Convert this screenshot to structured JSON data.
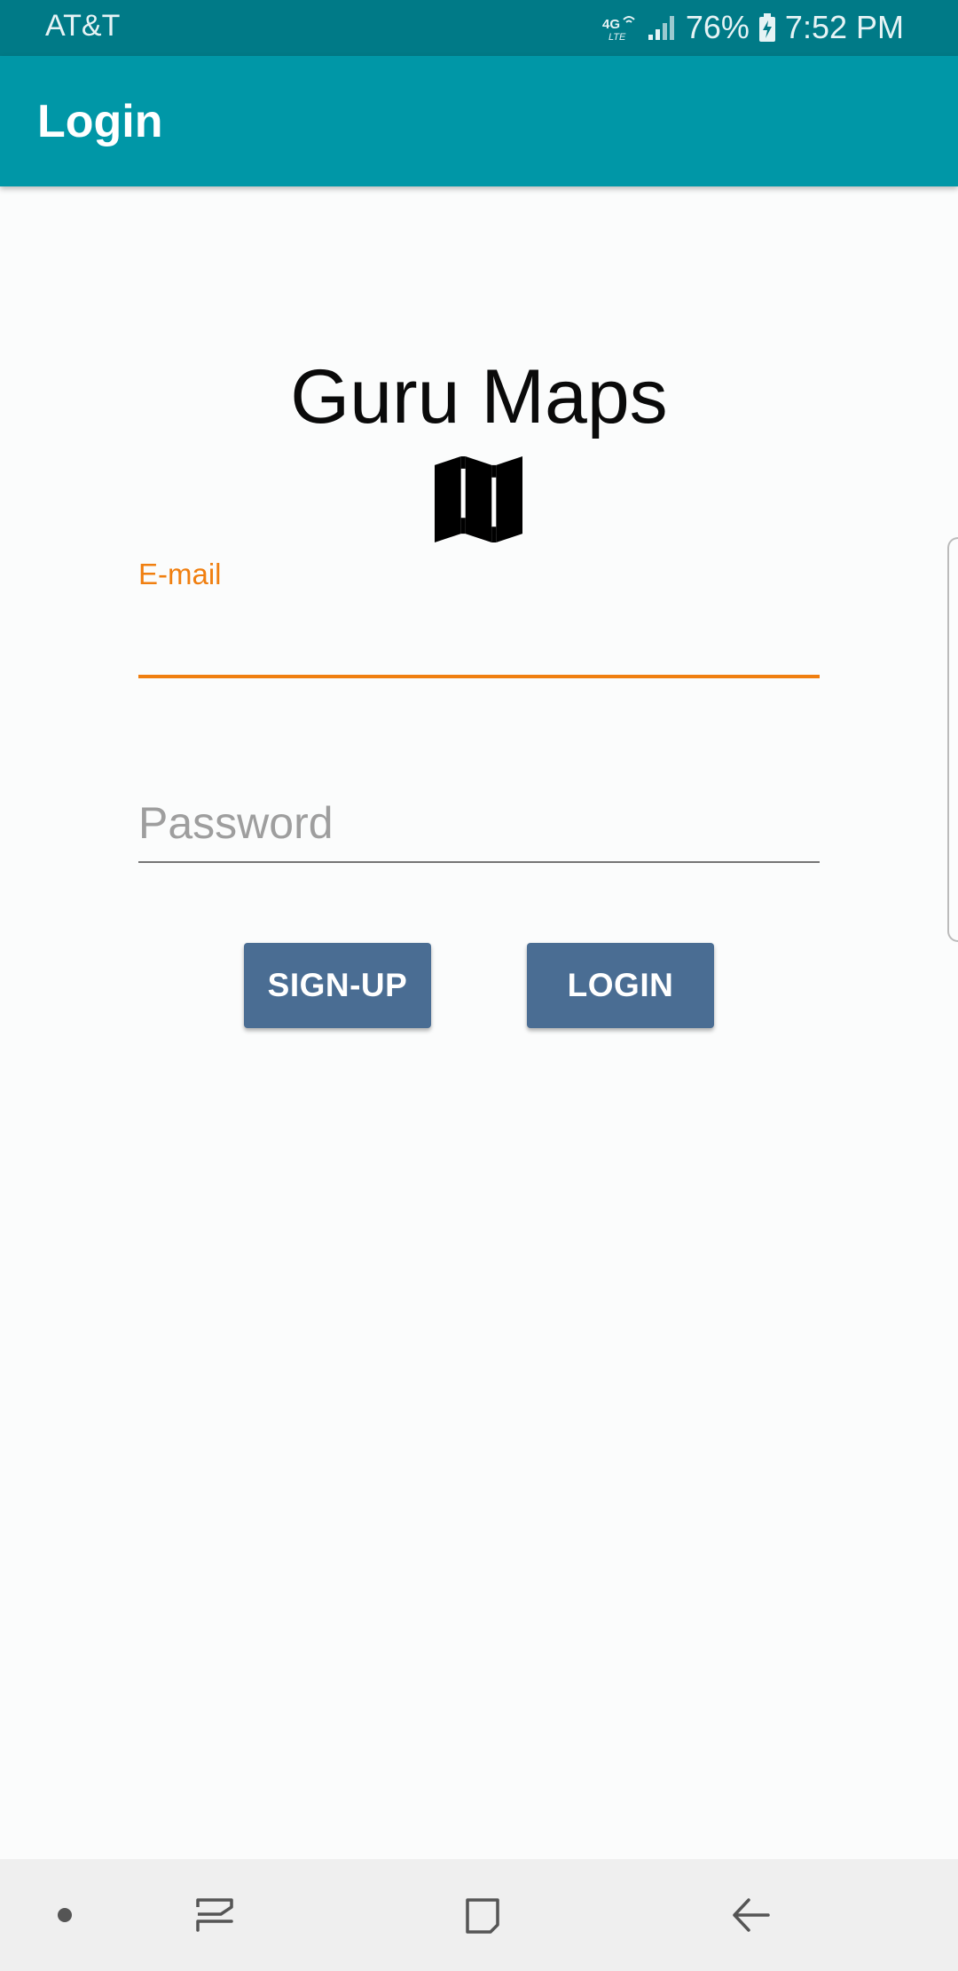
{
  "status_bar": {
    "carrier": "AT&T",
    "network": "4G LTE",
    "battery_percent": "76%",
    "time": "7:52 PM"
  },
  "app_bar": {
    "title": "Login",
    "color": "#0097a7"
  },
  "brand": {
    "title": "Guru Maps",
    "icon": "map-icon"
  },
  "form": {
    "email": {
      "label": "E-mail",
      "value": "",
      "accent_color": "#f07f10"
    },
    "password": {
      "placeholder": "Password",
      "value": ""
    }
  },
  "buttons": {
    "signup_label": "SIGN-UP",
    "login_label": "LOGIN",
    "color": "#4a6d93"
  },
  "nav_bar": {
    "items": [
      "dot-icon",
      "recent-apps-icon",
      "home-icon",
      "back-icon"
    ]
  }
}
